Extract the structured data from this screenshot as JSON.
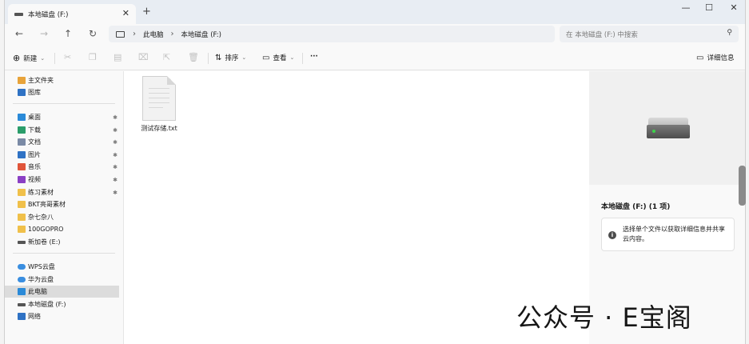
{
  "tab": {
    "title": "本地磁盘 (F:)",
    "close": "✕",
    "new_tab": "+"
  },
  "window_controls": {
    "minimize": "—",
    "maximize": "☐",
    "close": "✕"
  },
  "nav": {
    "back": "←",
    "forward": "→",
    "up": "↑",
    "refresh": "↻"
  },
  "address": {
    "separator": "›",
    "crumbs": [
      "此电脑",
      "本地磁盘 (F:)"
    ]
  },
  "search": {
    "placeholder": "在 本地磁盘 (F:) 中搜索",
    "icon": "search-icon"
  },
  "toolbar": {
    "new_label": "新建",
    "sort_label": "排序",
    "view_label": "查看",
    "more_label": "···",
    "details_label": "详细信息",
    "disabled_icons": [
      "cut-icon",
      "copy-icon",
      "paste-icon",
      "rename-icon",
      "share-icon",
      "delete-icon"
    ]
  },
  "sidebar": {
    "items": [
      {
        "label": "主文件夹",
        "icon": "home-icon",
        "color": "#e8a33a"
      },
      {
        "label": "图库",
        "icon": "gallery-icon",
        "color": "#2f72c4"
      },
      {
        "label": "桌面",
        "icon": "desktop-icon",
        "color": "#2a8ad8",
        "pinned": true
      },
      {
        "label": "下载",
        "icon": "download-icon",
        "color": "#2a9d6a",
        "pinned": true
      },
      {
        "label": "文档",
        "icon": "documents-icon",
        "color": "#7a8aa5",
        "pinned": true
      },
      {
        "label": "图片",
        "icon": "pictures-icon",
        "color": "#2f72c4",
        "pinned": true
      },
      {
        "label": "音乐",
        "icon": "music-icon",
        "color": "#e0553a",
        "pinned": true
      },
      {
        "label": "视频",
        "icon": "videos-icon",
        "color": "#8a3fc4",
        "pinned": true
      },
      {
        "label": "练习素材",
        "icon": "folder-icon",
        "color": "#f0c04a",
        "pinned": true
      },
      {
        "label": "BKT亮哥素材",
        "icon": "folder-icon",
        "color": "#f0c04a"
      },
      {
        "label": "杂七杂八",
        "icon": "folder-icon",
        "color": "#f0c04a"
      },
      {
        "label": "100GOPRO",
        "icon": "folder-icon",
        "color": "#f0c04a"
      },
      {
        "label": "新加卷 (E:)",
        "icon": "drive-icon",
        "color": "#555555"
      },
      {
        "label": "WPS云盘",
        "icon": "cloud-icon",
        "color": "#3a8ee0"
      },
      {
        "label": "华为云盘",
        "icon": "cloud-icon",
        "color": "#3a8ee0"
      },
      {
        "label": "此电脑",
        "icon": "this-pc-icon",
        "color": "#2a8ad8",
        "selected": true
      },
      {
        "label": "本地磁盘 (F:)",
        "icon": "drive-icon",
        "color": "#555555"
      },
      {
        "label": "网络",
        "icon": "network-icon",
        "color": "#2f72c4"
      }
    ],
    "pin_glyph": "📌"
  },
  "files": [
    {
      "name": "测试存储.txt",
      "icon": "text-file-icon"
    }
  ],
  "details_pane": {
    "title": "本地磁盘 (F:) (1 项)",
    "info_text": "选择单个文件以获取详细信息并共享云内容。",
    "info_icon": "i"
  },
  "watermark": "公众号 · E宝阁"
}
